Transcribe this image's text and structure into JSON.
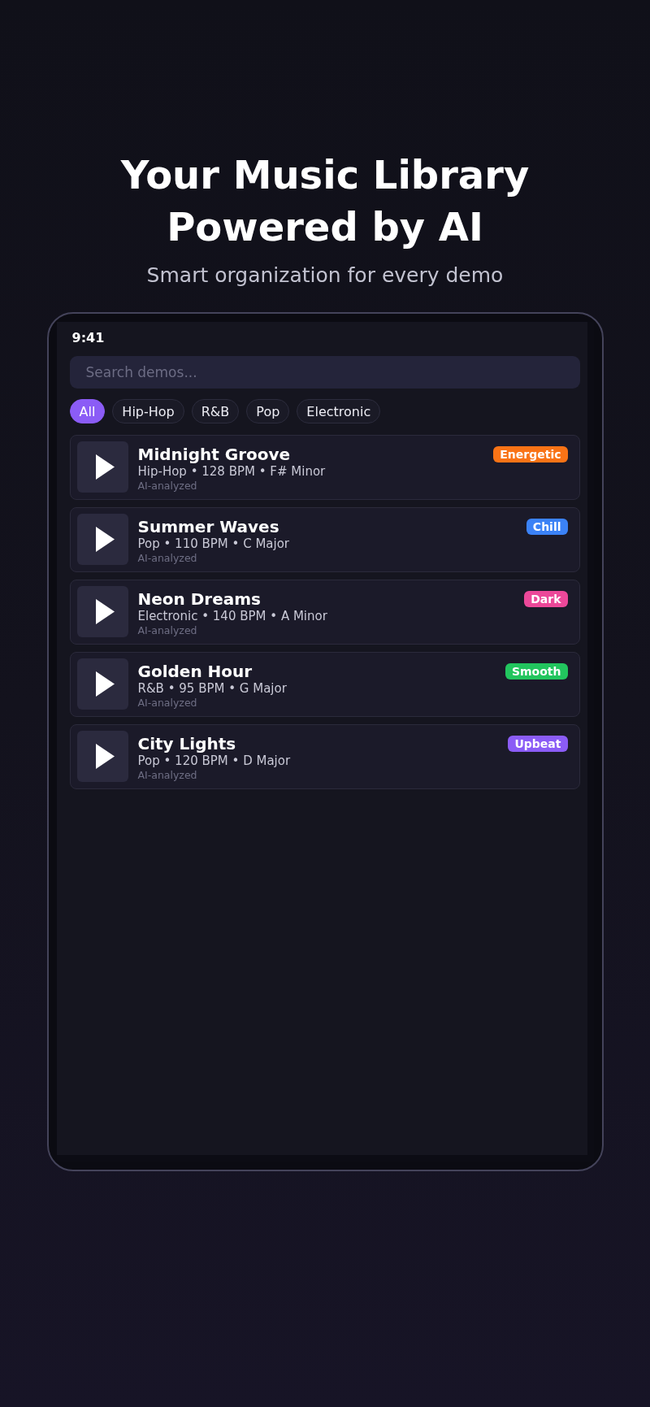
{
  "hero": {
    "title": "Your Music Library Powered by AI",
    "subtitle": "Smart organization for every demo"
  },
  "phone": {
    "status_time": "9:41",
    "search": {
      "placeholder": "Search demos..."
    },
    "filters": [
      {
        "label": "All",
        "selected": true
      },
      {
        "label": "Hip-Hop",
        "selected": false
      },
      {
        "label": "R&B",
        "selected": false
      },
      {
        "label": "Pop",
        "selected": false
      },
      {
        "label": "Electronic",
        "selected": false
      }
    ],
    "songs": [
      {
        "title": "Midnight Groove",
        "meta": "Hip-Hop • 128 BPM • F# Minor",
        "note": "AI-analyzed",
        "mood": {
          "label": "Energetic",
          "color": "#f97316"
        }
      },
      {
        "title": "Summer Waves",
        "meta": "Pop • 110 BPM • C Major",
        "note": "AI-analyzed",
        "mood": {
          "label": "Chill",
          "color": "#3b82f6"
        }
      },
      {
        "title": "Neon Dreams",
        "meta": "Electronic • 140 BPM • A Minor",
        "note": "AI-analyzed",
        "mood": {
          "label": "Dark",
          "color": "#ec4899"
        }
      },
      {
        "title": "Golden Hour",
        "meta": "R&B • 95 BPM • G Major",
        "note": "AI-analyzed",
        "mood": {
          "label": "Smooth",
          "color": "#22c55e"
        }
      },
      {
        "title": "City Lights",
        "meta": "Pop • 120 BPM • D Major",
        "note": "AI-analyzed",
        "mood": {
          "label": "Upbeat",
          "color": "#8b5cf6"
        }
      }
    ]
  }
}
